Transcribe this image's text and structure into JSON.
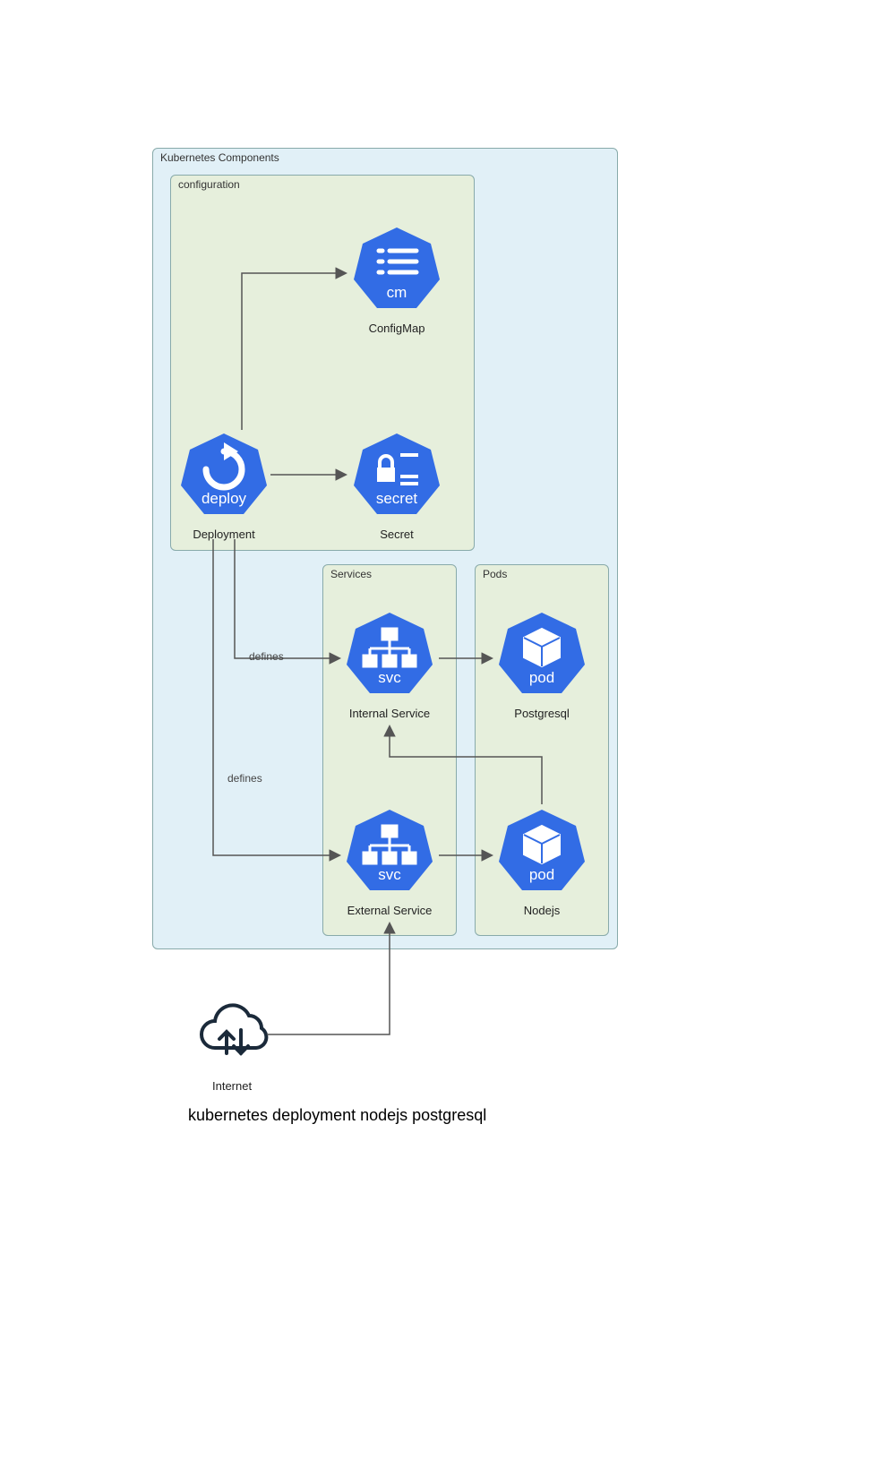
{
  "containers": {
    "k8s": "Kubernetes Components",
    "configuration": "configuration",
    "services": "Services",
    "pods": "Pods"
  },
  "nodes": {
    "deployment": {
      "label": "Deployment",
      "badge": "deploy"
    },
    "configmap": {
      "label": "ConfigMap",
      "badge": "cm"
    },
    "secret": {
      "label": "Secret",
      "badge": "secret"
    },
    "internalService": {
      "label": "Internal Service",
      "badge": "svc"
    },
    "externalService": {
      "label": "External Service",
      "badge": "svc"
    },
    "postgresql": {
      "label": "Postgresql",
      "badge": "pod"
    },
    "nodejs": {
      "label": "Nodejs",
      "badge": "pod"
    },
    "internet": {
      "label": "Internet"
    }
  },
  "edges": {
    "defines1": "defines",
    "defines2": "defines"
  },
  "caption": "kubernetes deployment nodejs postgresql"
}
